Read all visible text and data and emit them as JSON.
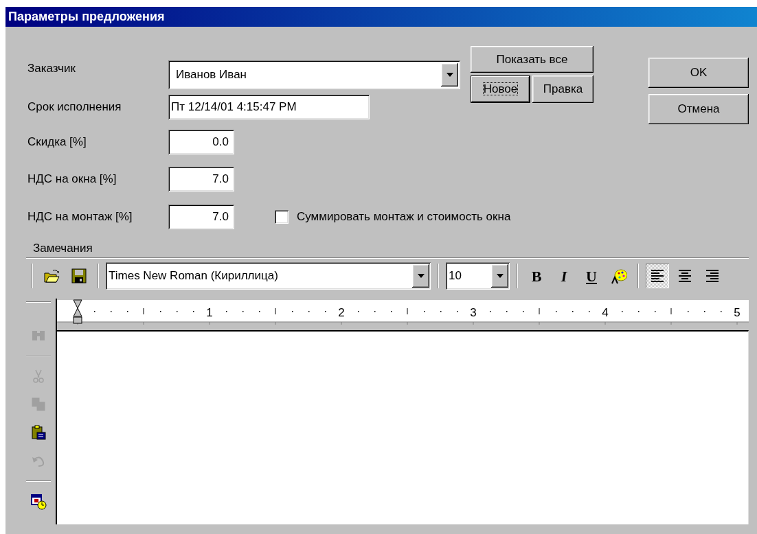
{
  "window": {
    "title": "Параметры предложения"
  },
  "fields": [
    {
      "label": "Заказчик",
      "kind": "combo",
      "value": "Иванов Иван"
    },
    {
      "label": "Срок исполнения",
      "kind": "text",
      "value": "Пт 12/14/01 4:15:47 PM"
    },
    {
      "label": "Скидка [%]",
      "kind": "number",
      "value": "0.0"
    },
    {
      "label": "НДС на окна [%]",
      "kind": "number",
      "value": "7.0"
    },
    {
      "label": "НДС на монтаж [%]",
      "kind": "number",
      "value": "7.0"
    }
  ],
  "customer_buttons": [
    {
      "label": "Показать все",
      "focused": false
    },
    {
      "label": "Новое",
      "focused": true
    },
    {
      "label": "Правка",
      "focused": false
    }
  ],
  "dialog_buttons": [
    {
      "label": "OK"
    },
    {
      "label": "Отмена"
    }
  ],
  "sum_checkbox": {
    "label": "Суммировать монтаж и стоимость окна",
    "checked": false
  },
  "notes": {
    "label": "Замечания"
  },
  "toolbar": [
    {
      "kind": "open"
    },
    {
      "kind": "save"
    },
    {
      "kind": "separator"
    },
    {
      "kind": "font",
      "value": "Times New Roman (Кириллица)"
    },
    {
      "kind": "separator"
    },
    {
      "kind": "size",
      "value": "10"
    },
    {
      "kind": "separator"
    },
    {
      "kind": "bold",
      "text": "B"
    },
    {
      "kind": "italic",
      "text": "I"
    },
    {
      "kind": "underline",
      "text": "U"
    },
    {
      "kind": "color"
    },
    {
      "kind": "separator"
    },
    {
      "kind": "align-left",
      "selected": true
    },
    {
      "kind": "align-center",
      "selected": false
    },
    {
      "kind": "align-right",
      "selected": false
    }
  ],
  "ruler": {
    "labels": [
      "1",
      "2",
      "3",
      "4",
      "5"
    ]
  },
  "side_toolbar": [
    {
      "kind": "find",
      "disabled": true
    },
    {
      "kind": "separator"
    },
    {
      "kind": "cut",
      "disabled": true
    },
    {
      "kind": "copy",
      "disabled": true
    },
    {
      "kind": "paste",
      "disabled": false
    },
    {
      "kind": "undo",
      "disabled": true
    },
    {
      "kind": "separator"
    },
    {
      "kind": "datetime",
      "disabled": false
    }
  ]
}
